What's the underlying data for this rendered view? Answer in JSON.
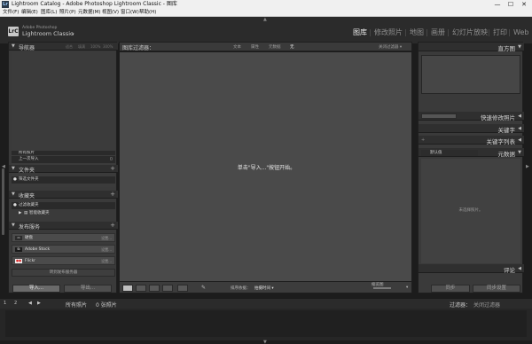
{
  "window": {
    "app_icon": "Lr",
    "title": "Lightroom Catalog - Adobe Photoshop Lightroom Classic - 图库",
    "min": "—",
    "max": "☐",
    "close": "✕"
  },
  "menu": [
    "文件(F)",
    "编辑(E)",
    "图库(L)",
    "照片(P)",
    "元数据(M)",
    "视图(V)",
    "窗口(W)",
    "帮助(H)"
  ],
  "identity": {
    "badge": "LrC",
    "company": "Adobe Photoshop",
    "product": "Lightroom Classic",
    "caret": "▾"
  },
  "modules": [
    {
      "label": "图库",
      "active": true
    },
    {
      "label": "修改照片",
      "active": false
    },
    {
      "label": "地图",
      "active": false
    },
    {
      "label": "画册",
      "active": false
    },
    {
      "label": "幻灯片放映",
      "active": false
    },
    {
      "label": "打印",
      "active": false
    },
    {
      "label": "Web",
      "active": false
    }
  ],
  "module_sep": "|",
  "arrows": {
    "up": "▲",
    "down": "▼",
    "left": "◀",
    "right": "▶"
  },
  "left_panel": {
    "navigator": {
      "label": "导航器",
      "zoom": [
        "适合",
        "填满",
        "100%",
        "300%"
      ]
    },
    "catalog_rows": [
      {
        "label": "所有照片",
        "count": ""
      },
      {
        "label": "上一次导入",
        "count": "0"
      }
    ],
    "folders": {
      "label": "文件夹",
      "filter_row": "筛选文件夹"
    },
    "collections": {
      "label": "收藏夹",
      "filter_row": "过滤收藏夹",
      "smart": "智能收藏夹"
    },
    "publish": {
      "label": "发布服务",
      "services": [
        {
          "icon": "disk-icon",
          "icon_text": "▭",
          "icon_bg": "#2a2a2a",
          "label": "硬盘",
          "action": "设置..."
        },
        {
          "icon": "adobe-stock-icon",
          "icon_text": "St",
          "icon_bg": "#1a1a1a",
          "label": "Adobe Stock",
          "action": "设置..."
        },
        {
          "icon": "flickr-icon",
          "icon_text": "●●",
          "icon_bg": "#eeeeee",
          "label": "Flickr",
          "action": "设置..."
        }
      ],
      "find_more": "转到发布服务器"
    },
    "plus": "+",
    "import_btn": "导入...",
    "export_btn": "导出..."
  },
  "filter_bar": {
    "title": "图库过滤器：",
    "options": [
      {
        "label": "文本",
        "active": false
      },
      {
        "label": "属性",
        "active": false
      },
      {
        "label": "元数据",
        "active": false
      },
      {
        "label": "无",
        "active": true
      }
    ],
    "preset": "关闭过滤器 ▾"
  },
  "grid": {
    "empty_message": "单击\"导入...\"按钮开始。"
  },
  "toolbar": {
    "sort_label": "排序依据：",
    "sort_value": "拍摄时间 ▾",
    "thumbs_label": "缩览图",
    "painter": "✎",
    "dropdown": "▾"
  },
  "right_panel": {
    "histogram": "直方图",
    "quick_develop": "快速修改照片",
    "keywording": "关键字",
    "keyword_list": "关键字列表",
    "metadata": "元数据",
    "metadata_preset": "默认值",
    "metadata_empty": "未选择照片。",
    "comments": "评论",
    "sync_meta_btn": "同步",
    "sync_settings_btn": "同步设置"
  },
  "filmstrip": {
    "page_labels": [
      "1",
      "2"
    ],
    "source": "所有照片",
    "count": "0 张照片",
    "filter_label": "过滤器：",
    "filter_value": "关闭过滤器"
  }
}
